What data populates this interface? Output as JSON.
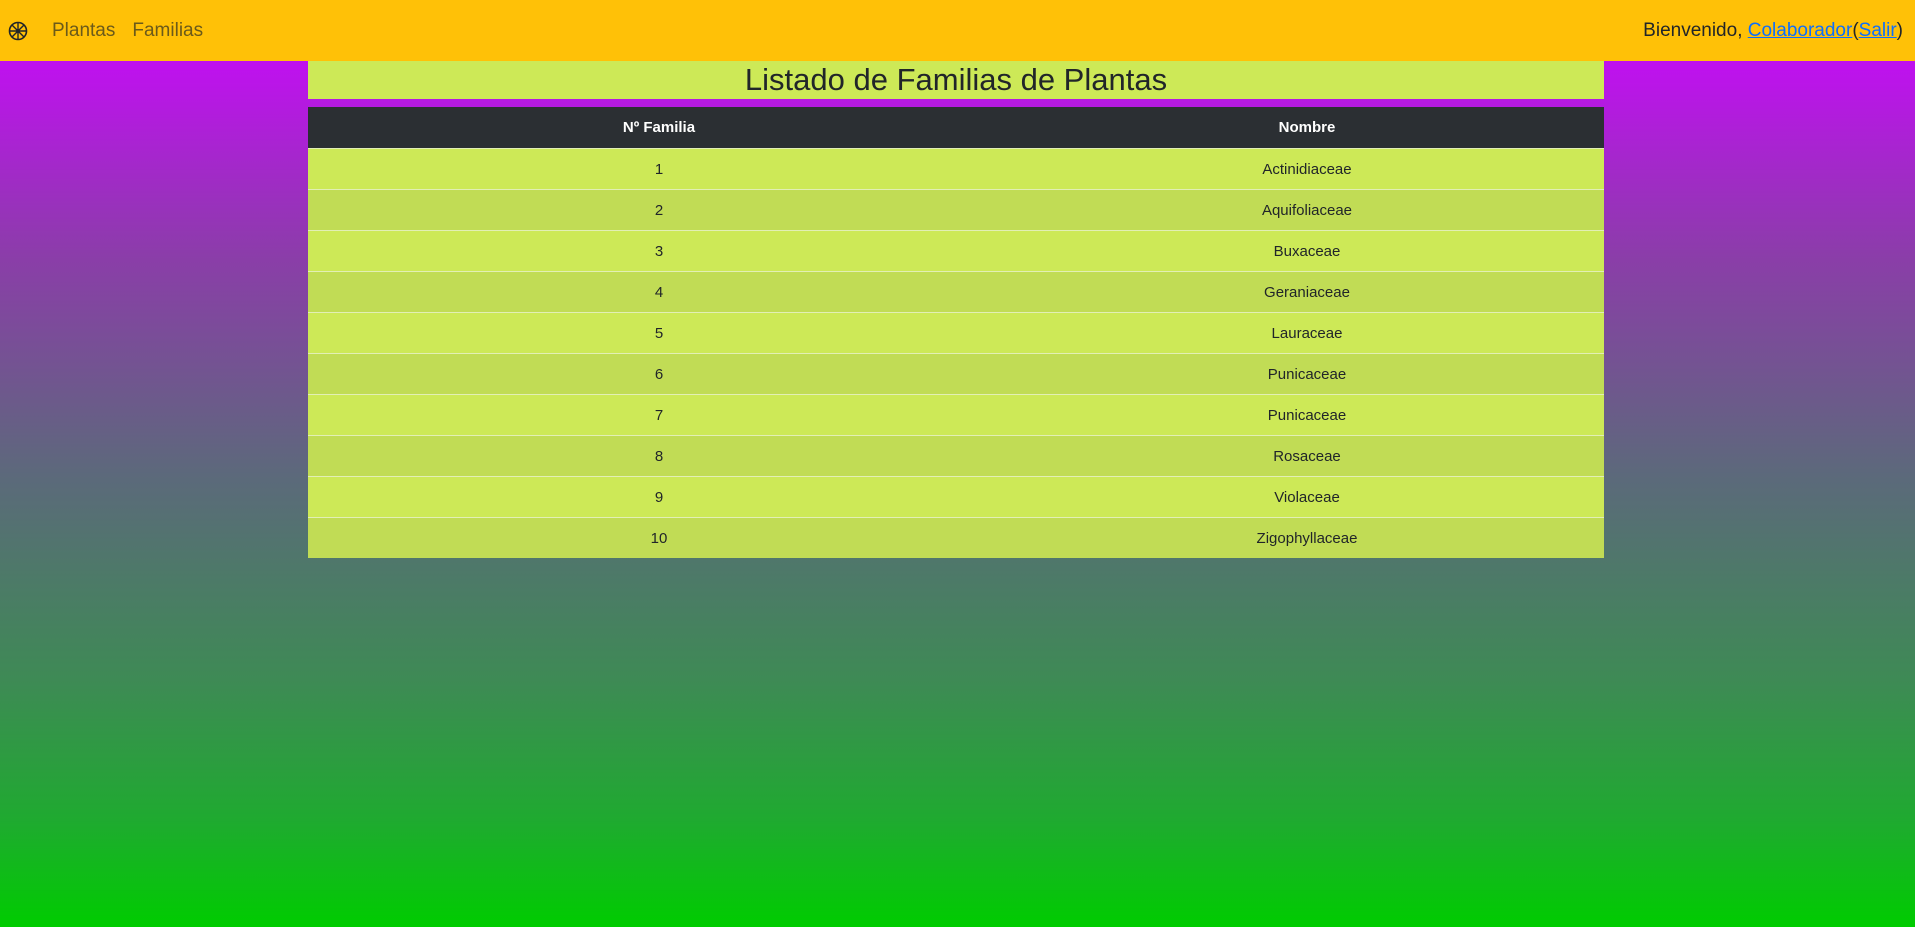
{
  "navbar": {
    "brand_icon": "flower-icon",
    "links": [
      "Plantas",
      "Familias"
    ],
    "welcome_text": "Bienvenido, ",
    "user_link": "Colaborador",
    "paren_open": "(",
    "logout_link": "Salir",
    "paren_close": ")",
    "background_color": "#ffc107"
  },
  "page": {
    "title": "Listado de Familias de Plantas"
  },
  "table": {
    "headers": [
      "Nº Familia",
      "Nombre"
    ],
    "rows": [
      {
        "num": "1",
        "name": "Actinidiaceae"
      },
      {
        "num": "2",
        "name": "Aquifoliaceae"
      },
      {
        "num": "3",
        "name": "Buxaceae"
      },
      {
        "num": "4",
        "name": "Geraniaceae"
      },
      {
        "num": "5",
        "name": "Lauraceae"
      },
      {
        "num": "6",
        "name": "Punicaceae"
      },
      {
        "num": "7",
        "name": "Punicaceae"
      },
      {
        "num": "8",
        "name": "Rosaceae"
      },
      {
        "num": "9",
        "name": "Violaceae"
      },
      {
        "num": "10",
        "name": "Zigophyllaceae"
      }
    ],
    "header_color": "#2b2f33",
    "row_color_odd": "#cde957",
    "row_color_even": "#c1dc55"
  }
}
